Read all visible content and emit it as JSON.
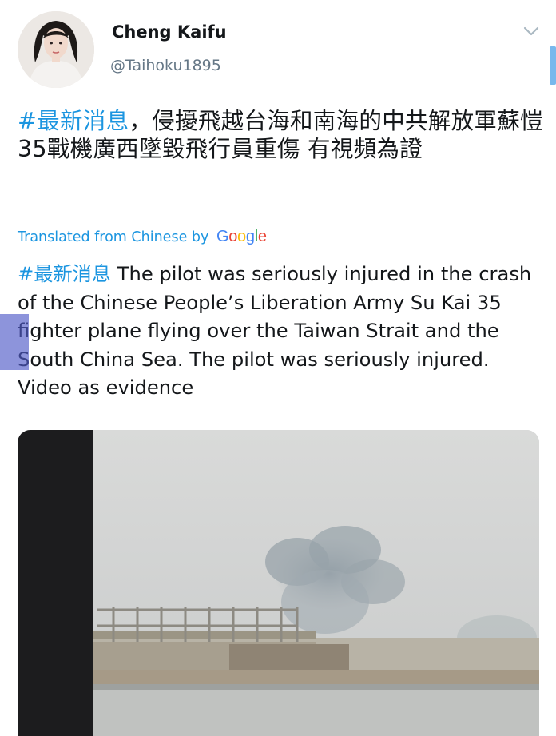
{
  "user": {
    "display_name": "Cheng Kaifu",
    "handle": "@Taihoku1895"
  },
  "tweet": {
    "hashtag": "#最新消息",
    "body": "，侵擾飛越台海和南海的中共解放軍蘇愷35戰機廣西墜毀飛行員重傷 有視頻為證"
  },
  "translation": {
    "label": "Translated from Chinese by",
    "provider": "Google",
    "hashtag": "#最新消息",
    "body": " The pilot was seriously injured in the crash of the Chinese People’s Liberation Army Su Kai 35 fighter plane flying over the Taiwan Strait and the South China Sea. The pilot was seriously injured. Video as evidence"
  },
  "icons": {
    "menu": "chevron-down-icon",
    "avatar": "user-avatar"
  },
  "colors": {
    "link": "#1b95e0",
    "text": "#14171a",
    "secondary": "#657786"
  }
}
